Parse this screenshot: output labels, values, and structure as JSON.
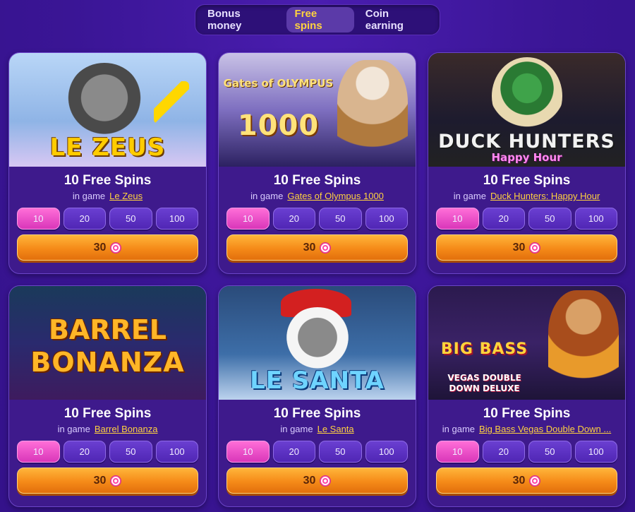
{
  "tabs": [
    {
      "label": "Bonus money",
      "active": false
    },
    {
      "label": "Free spins",
      "active": true
    },
    {
      "label": "Coin earning",
      "active": false
    }
  ],
  "card_common": {
    "in_game_prefix": "in game",
    "amounts": [
      "10",
      "20",
      "50",
      "100"
    ],
    "selected_amount": "10",
    "cost": "30",
    "cost_icon": "lollipop-candy-icon"
  },
  "cards": [
    {
      "title": "10 Free Spins",
      "game": "Le Zeus",
      "art_title": "LE ZEUS",
      "art_sub": ""
    },
    {
      "title": "10 Free Spins",
      "game": "Gates of Olympus 1000",
      "art_title": "1000",
      "art_sub": "Gates of OLYMPUS"
    },
    {
      "title": "10 Free Spins",
      "game": "Duck Hunters: Happy Hour",
      "art_title": "DUCK HUNTERS",
      "art_sub": "Happy Hour"
    },
    {
      "title": "10 Free Spins",
      "game": "Barrel Bonanza",
      "art_title": "BONANZA",
      "art_sub": "BARREL"
    },
    {
      "title": "10 Free Spins",
      "game": "Le Santa",
      "art_title": "LE SANTA",
      "art_sub": ""
    },
    {
      "title": "10 Free Spins",
      "game": "Big Bass Vegas Double Down ...",
      "art_title": "BIG BASS",
      "art_sub": "VEGAS DOUBLE DOWN DELUXE"
    }
  ],
  "colors": {
    "background": "#3a1595",
    "accent_yellow": "#ffd23f",
    "selected_pink": "#e14ac2",
    "cost_orange": "#f58a18"
  }
}
